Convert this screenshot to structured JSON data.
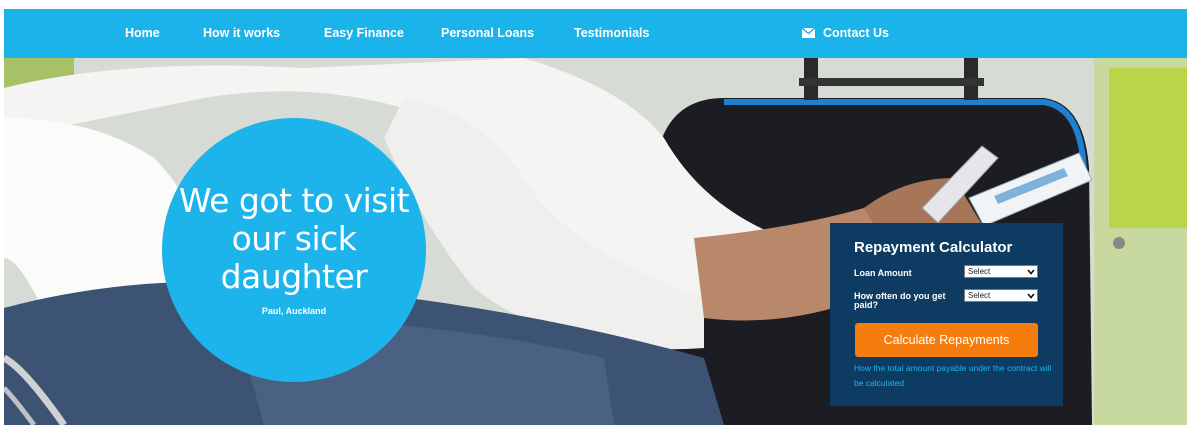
{
  "nav": {
    "items": [
      "Home",
      "How it works",
      "Easy Finance",
      "Personal Loans",
      "Testimonials"
    ],
    "contact_label": "Contact Us",
    "contact_icon": "envelope-icon",
    "background": "#1ab4ea"
  },
  "hero": {
    "quote_lines": [
      "We got to visit",
      "our sick",
      "daughter"
    ],
    "quote_author": "Paul, Auckland",
    "circle_color": "#1db4ec"
  },
  "calculator": {
    "title": "Repayment Calculator",
    "loan_amount_label": "Loan Amount",
    "loan_amount_value": "Select",
    "frequency_label": "How often do you get paid?",
    "frequency_value": "Select",
    "button_label": "Calculate Repayments",
    "note": "How the total amount payable under the contract will be calculated",
    "background": "#0d3b62",
    "button_color": "#f47d0e"
  }
}
